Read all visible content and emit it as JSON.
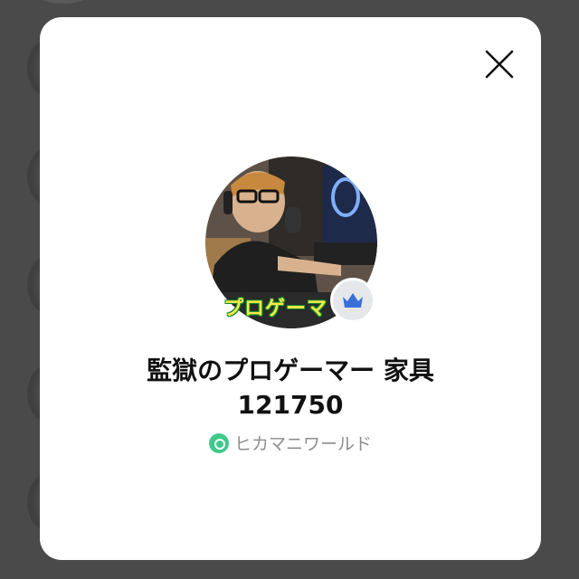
{
  "modal": {
    "title_line1": "監獄のプロゲーマー 家具",
    "title_line2": "121750",
    "community_name": "ヒカマニワールド",
    "avatar_overlay_text": "プロゲーマ",
    "close_icon": "close-icon",
    "badge_icon": "crown-icon",
    "community_icon": "community-icon"
  },
  "colors": {
    "backdrop": "#4a4a4a",
    "modal_bg": "#ffffff",
    "badge_bg": "#e6e7ea",
    "crown": "#3b6fd6",
    "community_icon": "#3ec98a",
    "community_text": "#8c8c8c"
  }
}
